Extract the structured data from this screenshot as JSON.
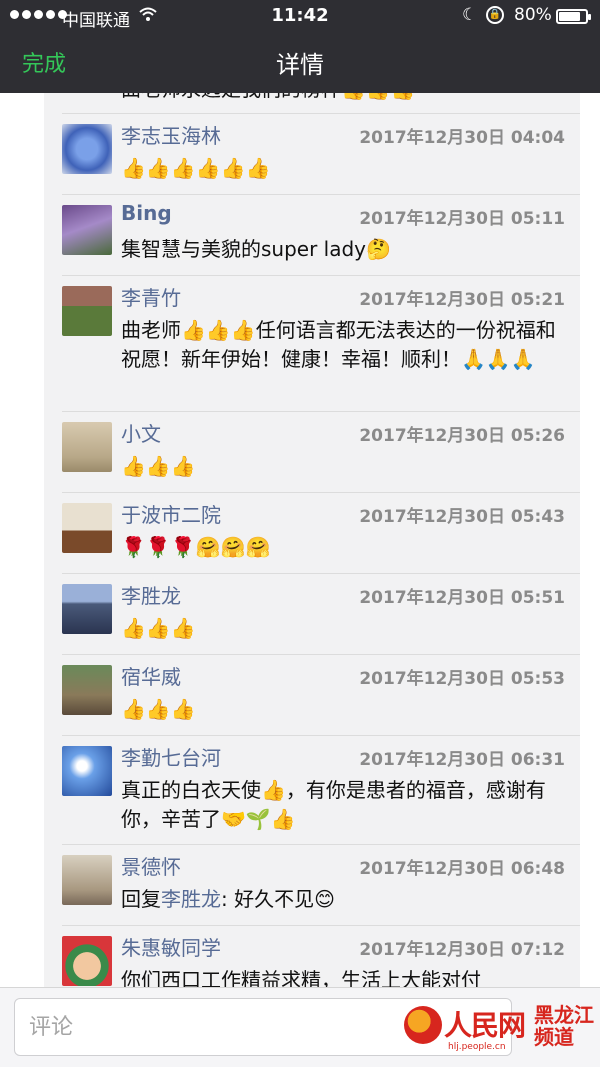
{
  "status_bar": {
    "carrier": "中国联通",
    "time": "11:42",
    "battery": "80%",
    "battery_level": 0.8,
    "icons": [
      "signal-dots-icon",
      "wifi-icon",
      "moon-icon",
      "rotation-lock-icon",
      "battery-icon"
    ]
  },
  "nav": {
    "done": "完成",
    "title": "详情"
  },
  "colors": {
    "accent_green": "#34c759",
    "name_blue": "#576b95",
    "header_bg": "#2e2e33",
    "watermark_red": "#d7261e"
  },
  "partial_top": {
    "text": "曲老师永远是我们的榜样👍👍👍"
  },
  "comments": [
    {
      "name": "李志玉海林",
      "time": "2017年12月30日 04:04",
      "text": "👍👍👍👍👍👍",
      "avatar": "blue-flowers"
    },
    {
      "name": "Bing",
      "time": "2017年12月30日 05:11",
      "text": "集智慧与美貌的super lady🤔",
      "avatar": "lavender"
    },
    {
      "name": "李青竹",
      "time": "2017年12月30日 05:21",
      "text": "曲老师👍👍👍任何语言都无法表达的一份祝福和祝愿！新年伊始！健康！幸福！顺利！🙏🙏🙏",
      "avatar": "garden-house"
    },
    {
      "name": "小文",
      "time": "2017年12月30日 05:26",
      "text": "👍👍👍",
      "avatar": "beach"
    },
    {
      "name": "于波市二院",
      "time": "2017年12月30日 05:43",
      "text": "🌹🌹🌹🤗🤗🤗",
      "avatar": "room-flowers"
    },
    {
      "name": "李胜龙",
      "time": "2017年12月30日 05:51",
      "text": "👍👍👍",
      "avatar": "lake"
    },
    {
      "name": "宿华威",
      "time": "2017年12月30日 05:53",
      "text": "👍👍👍",
      "avatar": "buddha-statue"
    },
    {
      "name": "李勤七台河",
      "time": "2017年12月30日 06:31",
      "text": "真正的白衣天使👍，有你是患者的福音，感谢有你，辛苦了🤝🌱👍",
      "avatar": "sunflower-sky"
    },
    {
      "name": "景德怀",
      "time": "2017年12月30日 06:48",
      "reply_prefix": "回复",
      "reply_to": "李胜龙",
      "reply_text": ": 好久不见😊",
      "avatar": "child-outdoor"
    },
    {
      "name": "朱惠敏同学",
      "time": "2017年12月30日 07:12",
      "text": "你们西口工作精益求精，生活上大能对付",
      "avatar": "cartoon-face"
    }
  ],
  "input": {
    "placeholder": "评论"
  },
  "watermark": {
    "brand": "人民网",
    "url": "hlj.people.cn",
    "channel": "黑龙江频道"
  }
}
